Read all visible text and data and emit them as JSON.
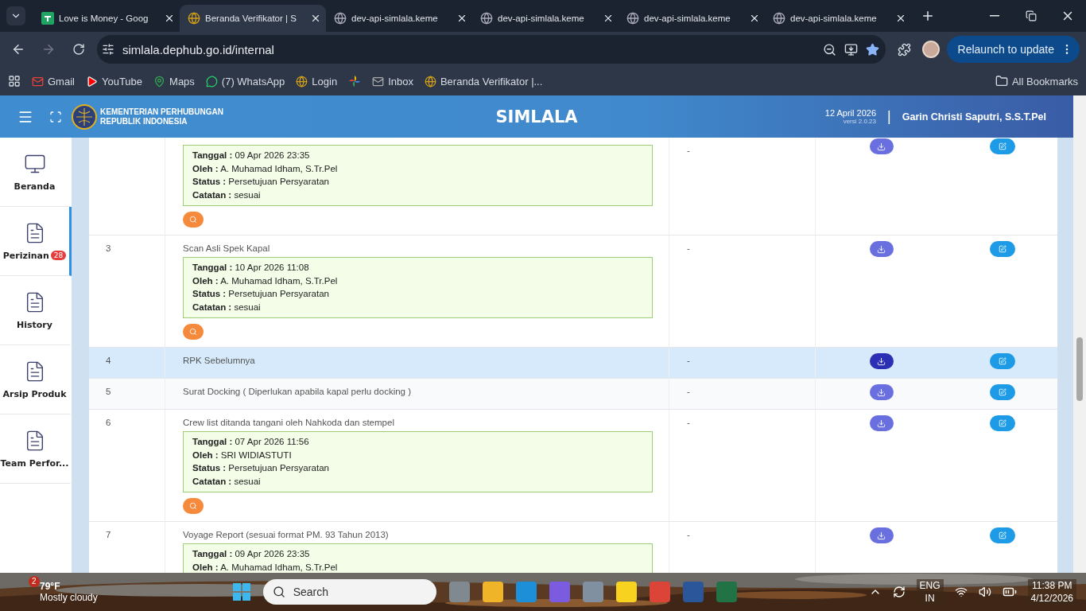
{
  "browser": {
    "tabs": [
      {
        "title": "Love is Money - Goog",
        "selected": false
      },
      {
        "title": "Beranda Verifikator | S",
        "selected": true
      },
      {
        "title": "dev-api-simlala.keme",
        "selected": false
      },
      {
        "title": "dev-api-simlala.keme",
        "selected": false
      },
      {
        "title": "dev-api-simlala.keme",
        "selected": false
      },
      {
        "title": "dev-api-simlala.keme",
        "selected": false
      }
    ],
    "url": "simlala.dephub.go.id/internal",
    "relaunch": "Relaunch to update",
    "bookmarks": [
      {
        "kind": "link",
        "label": "Gmail"
      },
      {
        "kind": "link",
        "label": "YouTube"
      },
      {
        "kind": "link",
        "label": "Maps"
      },
      {
        "kind": "link",
        "label": "(7) WhatsApp"
      },
      {
        "kind": "link",
        "label": "Login"
      },
      {
        "kind": "icon"
      },
      {
        "kind": "link",
        "label": "Inbox"
      },
      {
        "kind": "link",
        "label": "Beranda Verifikator |..."
      }
    ],
    "all_bookmarks": "All Bookmarks"
  },
  "header": {
    "org_line1": "KEMENTERIAN PERHUBUNGAN",
    "org_line2": "REPUBLIK INDONESIA",
    "app_title": "SIMLALA",
    "date": "12 April 2026",
    "version": "versi 2.0.23",
    "separator": "|",
    "user": "Garin Christi Saputri, S.S.T.Pel"
  },
  "sidebar": [
    {
      "label": "Beranda",
      "selected": false
    },
    {
      "label": "Perizinan",
      "badge": "28",
      "selected": true
    },
    {
      "label": "History",
      "selected": false
    },
    {
      "label": "Arsip Produk",
      "selected": false
    },
    {
      "label": "Team Perfor...",
      "selected": false
    }
  ],
  "rows": [
    {
      "kind": "record",
      "col3": "-",
      "selected": false,
      "record": [
        "**Tanggal :** 09 Apr 2026 23:35",
        "**Oleh :** A. Muhamad Idham, S.Tr.Pel",
        "**Status :** Persetujuan Persyaratan",
        "**Catatan :** sesuai"
      ]
    },
    {
      "kind": "record",
      "number": "3",
      "title": "Scan Asli Spek Kapal",
      "col3": "-",
      "selected": false,
      "record": [
        "**Tanggal :** 10 Apr 2026 11:08",
        "**Oleh :** A. Muhamad Idham, S.Tr.Pel",
        "**Status :** Persetujuan Persyaratan",
        "**Catatan :** sesuai"
      ]
    },
    {
      "kind": "plain",
      "number": "4",
      "title": "RPK Sebelumnya",
      "col3": "-",
      "selected": true
    },
    {
      "kind": "plain",
      "number": "5",
      "title": "Surat Docking ( Diperlukan apabila kapal perlu docking )",
      "col3": "-",
      "selected": false
    },
    {
      "kind": "record",
      "number": "6",
      "title": "Crew list ditanda tangani oleh Nahkoda dan stempel",
      "col3": "-",
      "selected": false,
      "record": [
        "**Tanggal :** 07 Apr 2026 11:56",
        "**Oleh :** SRI WIDIASTUTI",
        "**Status :** Persetujuan Persyaratan",
        "**Catatan :** sesuai"
      ]
    },
    {
      "kind": "record",
      "number": "7",
      "title": "Voyage Report (sesuai format PM. 93 Tahun 2013)",
      "col3": "-",
      "selected": false,
      "record": [
        "**Tanggal :** 09 Apr 2026 23:35",
        "**Oleh :** A. Muhamad Idham, S.Tr.Pel"
      ]
    }
  ],
  "taskbar": {
    "weather_badge": "2",
    "temperature": "79°F",
    "weather": "Mostly cloudy",
    "search": "Search",
    "language": "ENG",
    "region": "IN",
    "time": "11:38 PM",
    "date": "4/12/2026"
  }
}
